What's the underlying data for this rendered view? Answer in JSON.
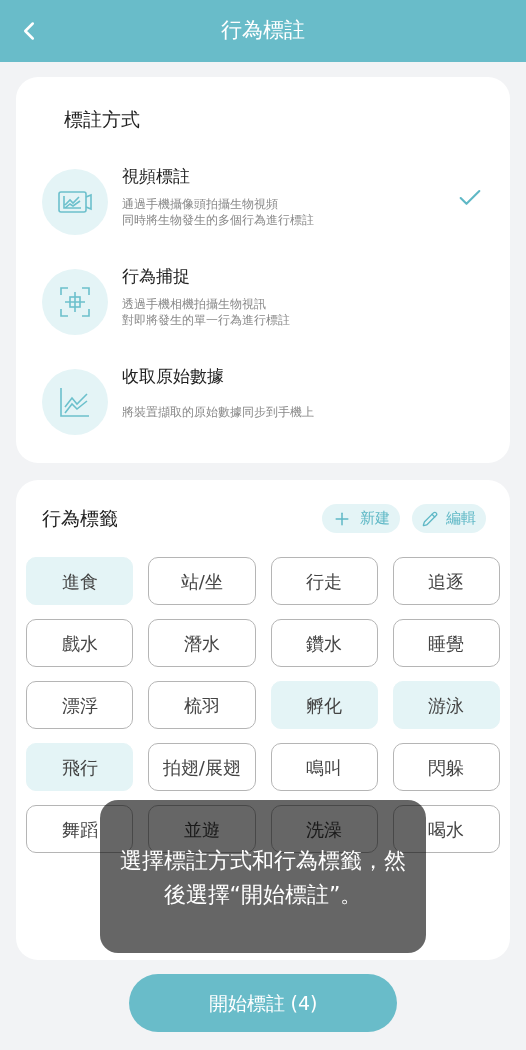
{
  "header": {
    "title": "行為標註"
  },
  "methods": {
    "title": "標註方式",
    "items": [
      {
        "kind": "video",
        "title": "視頻標註",
        "description": [
          "通過手機攝像頭拍攝生物視頻",
          "同時將生物發生的多個行為進行標註"
        ],
        "selected": true
      },
      {
        "kind": "capture",
        "title": "行為捕捉",
        "description": [
          "透過手機相機拍攝生物視訊",
          "對即將發生的單一行為進行標註"
        ],
        "selected": false
      },
      {
        "kind": "raw",
        "title": "收取原始數據",
        "description": [
          "將裝置擷取的原始數據同步到手機上"
        ],
        "selected": false
      }
    ]
  },
  "tags": {
    "title": "行為標籤",
    "actions": [
      {
        "kind": "add",
        "label": "新建"
      },
      {
        "kind": "edit",
        "label": "編輯"
      }
    ],
    "items": [
      {
        "label": "進食",
        "selected": true
      },
      {
        "label": "站/坐",
        "selected": false
      },
      {
        "label": "行走",
        "selected": false
      },
      {
        "label": "追逐",
        "selected": false
      },
      {
        "label": "戲水",
        "selected": false
      },
      {
        "label": "潛水",
        "selected": false
      },
      {
        "label": "鑽水",
        "selected": false
      },
      {
        "label": "睡覺",
        "selected": false
      },
      {
        "label": "漂浮",
        "selected": false
      },
      {
        "label": "梳羽",
        "selected": false
      },
      {
        "label": "孵化",
        "selected": true
      },
      {
        "label": "游泳",
        "selected": true
      },
      {
        "label": "飛行",
        "selected": true
      },
      {
        "label": "拍翅/展翅",
        "selected": false
      },
      {
        "label": "鳴叫",
        "selected": false
      },
      {
        "label": "閃躲",
        "selected": false
      },
      {
        "label": "舞蹈",
        "selected": false
      },
      {
        "label": "並遊",
        "selected": false
      },
      {
        "label": "洗澡",
        "selected": false
      },
      {
        "label": "喝水",
        "selected": false
      }
    ]
  },
  "toast": {
    "lines": [
      "選擇標註方式和行為標籤，然",
      "後選擇“開始標註”。"
    ]
  },
  "start_button": {
    "label": "開始標註 (4)"
  }
}
